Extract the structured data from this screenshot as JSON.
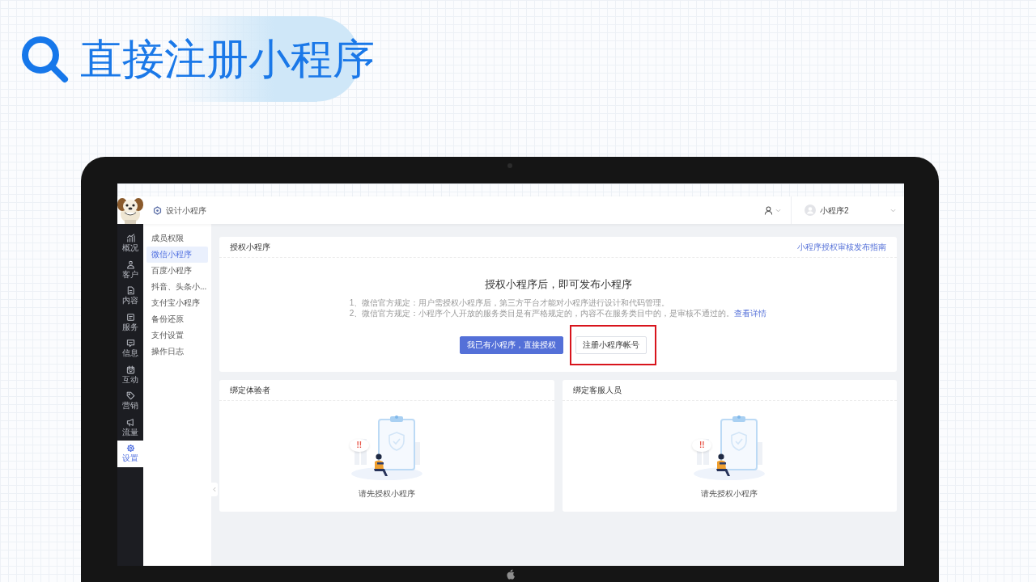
{
  "heading": {
    "title": "直接注册小程序"
  },
  "app": {
    "top_bar": {
      "page_title": "设计小程序",
      "account_name": "小程序2"
    },
    "rail": [
      {
        "label": "概况",
        "selected": false
      },
      {
        "label": "客户",
        "selected": false
      },
      {
        "label": "内容",
        "selected": false
      },
      {
        "label": "服务",
        "selected": false
      },
      {
        "label": "信息",
        "selected": false
      },
      {
        "label": "互动",
        "selected": false
      },
      {
        "label": "营销",
        "selected": false
      },
      {
        "label": "流量",
        "selected": false
      },
      {
        "label": "设置",
        "selected": true
      }
    ],
    "sub_nav": [
      {
        "label": "成员权限",
        "selected": false
      },
      {
        "label": "微信小程序",
        "selected": true
      },
      {
        "label": "百度小程序",
        "selected": false
      },
      {
        "label": "抖音、头条小...",
        "selected": false
      },
      {
        "label": "支付宝小程序",
        "selected": false
      },
      {
        "label": "备份还原",
        "selected": false
      },
      {
        "label": "支付设置",
        "selected": false
      },
      {
        "label": "操作日志",
        "selected": false
      }
    ],
    "auth_card": {
      "title": "授权小程序",
      "guide_link": "小程序授权审核发布指南",
      "headline": "授权小程序后，即可发布小程序",
      "notes": [
        {
          "text": "1、微信官方规定：用户需授权小程序后，第三方平台才能对小程序进行设计和代码管理。"
        },
        {
          "text": "2、微信官方规定：小程序个人开放的服务类目是有严格规定的，内容不在服务类目中的，是审核不通过的。",
          "link": "查看详情"
        }
      ],
      "buttons": [
        {
          "label": "我已有小程序，直接授权",
          "kind": "primary",
          "highlighted": false
        },
        {
          "label": "注册小程序帐号",
          "kind": "outline",
          "highlighted": true
        }
      ]
    },
    "bind_cards": [
      {
        "title": "绑定体验者",
        "alert_text": "!!",
        "message": "请先授权小程序"
      },
      {
        "title": "绑定客服人员",
        "alert_text": "!!",
        "message": "请先授权小程序"
      }
    ]
  }
}
